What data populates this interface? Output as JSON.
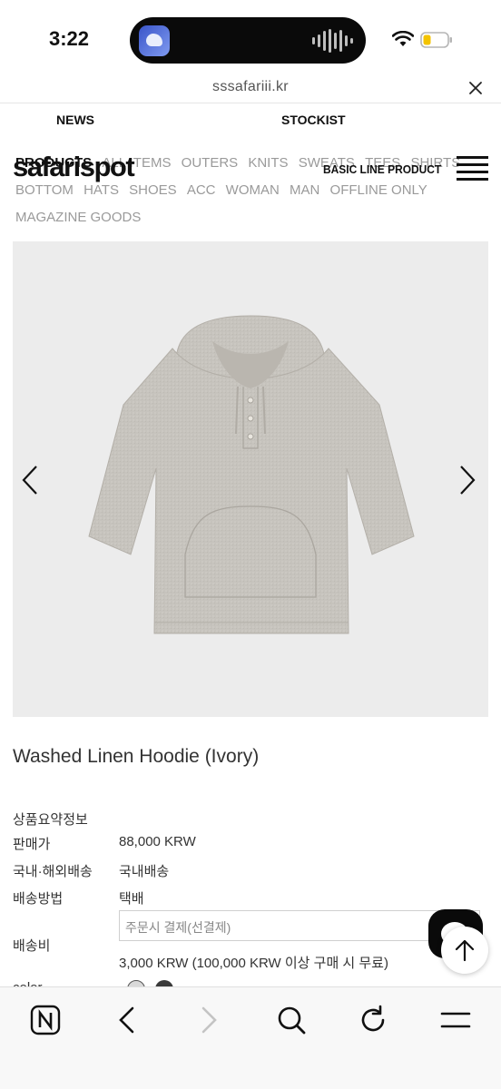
{
  "status_bar": {
    "time": "3:22",
    "battery_color": "#f3c300"
  },
  "browser": {
    "url": "sssafariii.kr"
  },
  "site": {
    "nav_top": [
      "NEWS",
      "STOCKIST"
    ],
    "logo": "safarispot",
    "basic_line": "BASIC LINE PRODUCT",
    "categories_row1": [
      "PRODUCTS",
      "ALL ITEMS",
      "OUTERS",
      "KNITS",
      "SWEATS",
      "TEES",
      "SHIRTS"
    ],
    "categories_row2": [
      "BOTTOM",
      "HATS",
      "SHOES",
      "ACC",
      "WOMAN",
      "MAN",
      "OFFLINE ONLY"
    ],
    "categories_row3": [
      "MAGAZINE GOODS"
    ]
  },
  "product": {
    "title": "Washed Linen Hoodie (Ivory)",
    "info_heading": "상품요약정보",
    "rows": [
      {
        "label": "판매가",
        "value": "88,000 KRW"
      },
      {
        "label": "국내·해외배송",
        "value": "국내배송"
      },
      {
        "label": "배송방법",
        "value": "택배"
      }
    ],
    "shipping_fee_label": "배송비",
    "shipping_select": "주문시 결제(선결제)",
    "shipping_fee_value": "3,000 KRW (100,000 KRW 이상 구매 시 무료)",
    "color_label": "color",
    "swatch_colors": [
      "#d9d9d9",
      "#3a3a3a"
    ]
  },
  "icons": {
    "toolbar": [
      "naver-icon",
      "back-icon",
      "forward-icon",
      "search-icon",
      "reload-icon",
      "menu-icon"
    ]
  }
}
